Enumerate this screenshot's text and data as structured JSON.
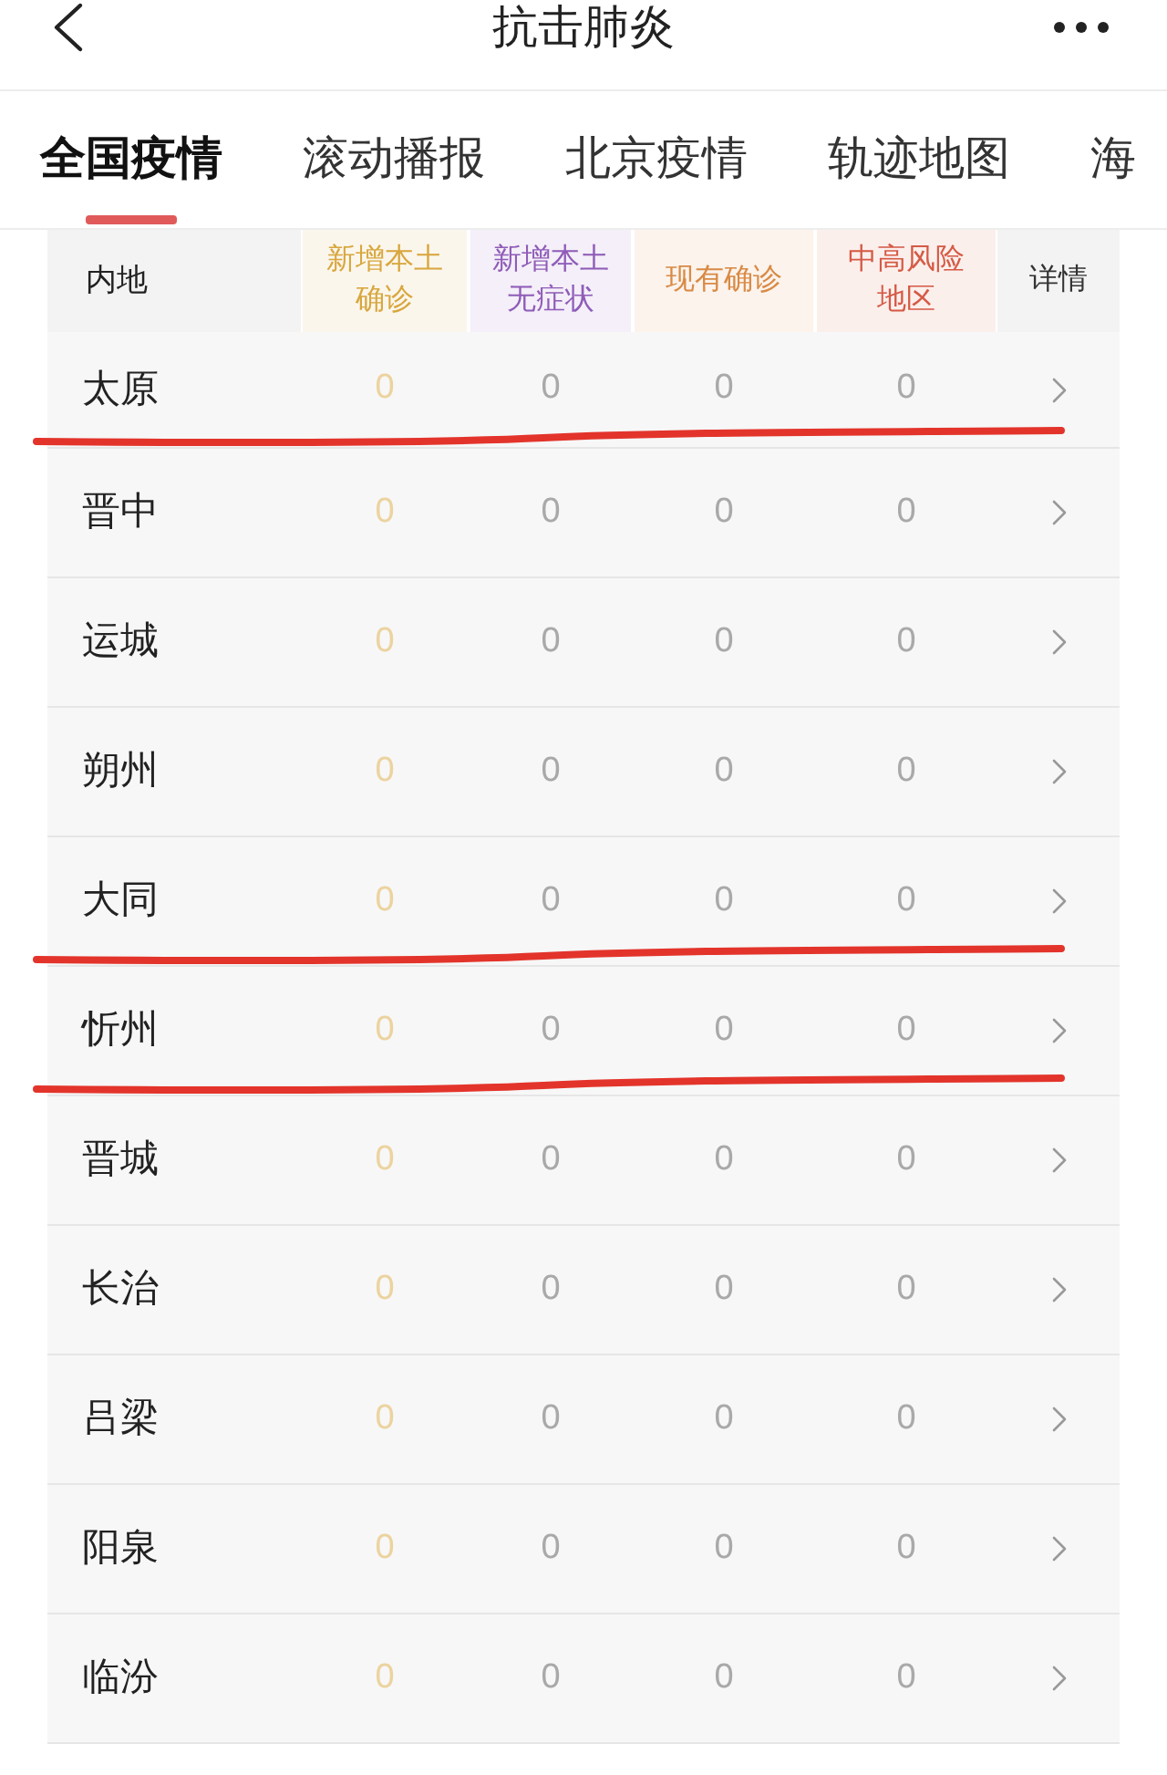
{
  "header": {
    "title": "抗击肺炎"
  },
  "tabs": [
    {
      "label": "全国疫情",
      "selected": true
    },
    {
      "label": "滚动播报",
      "selected": false
    },
    {
      "label": "北京疫情",
      "selected": false
    },
    {
      "label": "轨迹地图",
      "selected": false
    },
    {
      "label": "海",
      "selected": false
    }
  ],
  "table": {
    "columns": [
      {
        "label": "内地",
        "kind": "name"
      },
      {
        "label": "新增本土确诊",
        "kind": "tinted",
        "color": "#d8a73e"
      },
      {
        "label": "新增本土无症状",
        "kind": "plain",
        "color": "#8f5cb8"
      },
      {
        "label": "现有确诊",
        "kind": "plain",
        "color": "#d98a45"
      },
      {
        "label": "中高风险地区",
        "kind": "plain",
        "color": "#d55a45"
      },
      {
        "label": "详情",
        "kind": "detail"
      }
    ],
    "rows": [
      {
        "name": "太原",
        "values": [
          "0",
          "0",
          "0",
          "0"
        ],
        "underlined": true
      },
      {
        "name": "晋中",
        "values": [
          "0",
          "0",
          "0",
          "0"
        ],
        "underlined": false
      },
      {
        "name": "运城",
        "values": [
          "0",
          "0",
          "0",
          "0"
        ],
        "underlined": false
      },
      {
        "name": "朔州",
        "values": [
          "0",
          "0",
          "0",
          "0"
        ],
        "underlined": false
      },
      {
        "name": "大同",
        "values": [
          "0",
          "0",
          "0",
          "0"
        ],
        "underlined": true
      },
      {
        "name": "忻州",
        "values": [
          "0",
          "0",
          "0",
          "0"
        ],
        "underlined": true
      },
      {
        "name": "晋城",
        "values": [
          "0",
          "0",
          "0",
          "0"
        ],
        "underlined": false
      },
      {
        "name": "长治",
        "values": [
          "0",
          "0",
          "0",
          "0"
        ],
        "underlined": false
      },
      {
        "name": "吕梁",
        "values": [
          "0",
          "0",
          "0",
          "0"
        ],
        "underlined": false
      },
      {
        "name": "阳泉",
        "values": [
          "0",
          "0",
          "0",
          "0"
        ],
        "underlined": false
      },
      {
        "name": "临汾",
        "values": [
          "0",
          "0",
          "0",
          "0"
        ],
        "underlined": false
      }
    ]
  }
}
